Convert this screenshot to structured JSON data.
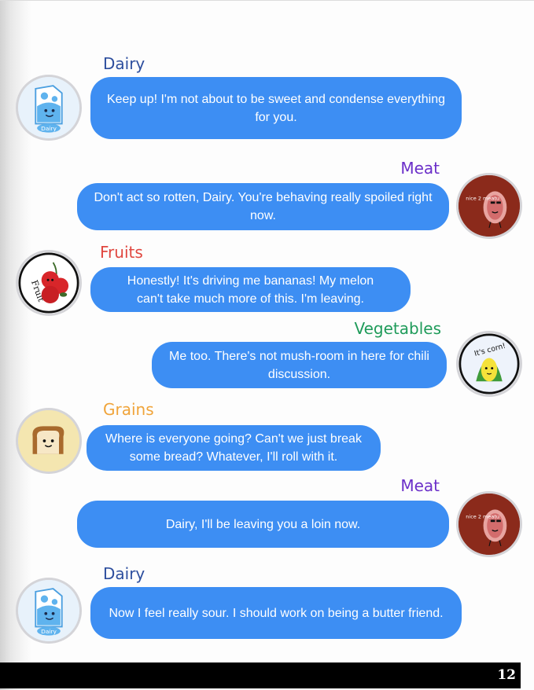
{
  "messages": [
    {
      "speaker": "Dairy",
      "text": "Keep up! I'm not about to be sweet and condense everything for you.",
      "avatar_icon": "milk-carton-icon",
      "avatar_label": "Dairy"
    },
    {
      "speaker": "Meat",
      "text": "Don't act so rotten, Dairy. You're behaving really spoiled right now.",
      "avatar_icon": "steak-icon",
      "avatar_label": "nice 2 meatu"
    },
    {
      "speaker": "Fruits",
      "text": "Honestly! It's driving me bananas! My melon can't take much more of this. I'm leaving.",
      "avatar_icon": "cherries-icon",
      "avatar_label": "Fruit"
    },
    {
      "speaker": "Vegetables",
      "text": "Me too. There's not mush-room in here for chili discussion.",
      "avatar_icon": "corn-icon",
      "avatar_label": "It's corn!"
    },
    {
      "speaker": "Grains",
      "text": "Where is everyone going? Can't we just break some bread? Whatever, I'll roll with it.",
      "avatar_icon": "bread-icon",
      "avatar_label": ""
    },
    {
      "speaker": "Meat",
      "text": "Dairy, I'll be leaving you a loin now.",
      "avatar_icon": "steak-icon",
      "avatar_label": "nice 2 meatu"
    },
    {
      "speaker": "Dairy",
      "text": "Now I feel really sour. I should work on being a butter friend.",
      "avatar_icon": "milk-carton-icon",
      "avatar_label": "Dairy"
    }
  ],
  "colors": {
    "bubble": "#3d8ef3",
    "dairy": "#2d4e9e",
    "meat": "#6b2fc9",
    "fruits": "#e0463f",
    "vegetables": "#1f9b5a",
    "grains": "#f0a43a"
  },
  "page_number": "12"
}
